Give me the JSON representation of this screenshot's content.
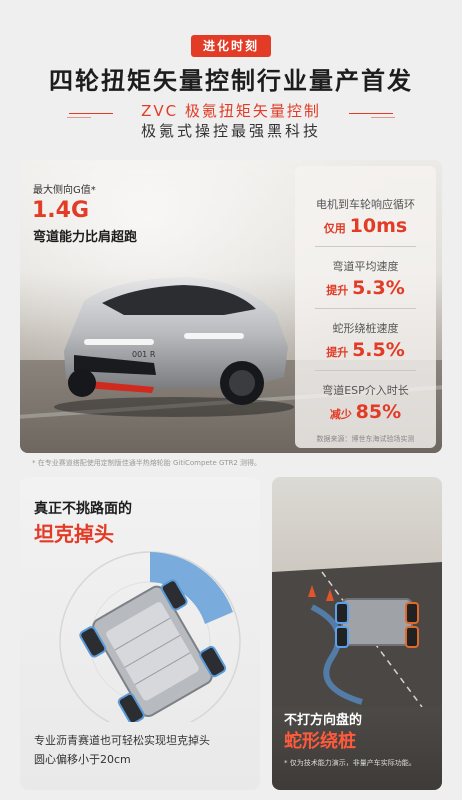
{
  "header": {
    "tag": "进化时刻",
    "headline": "四轮扭矩矢量控制行业量产首发",
    "subtitle_red": "ZVC 极氪扭矩矢量控制",
    "subtitle_dark": "极氪式操控最强黑科技"
  },
  "hero": {
    "g_label": "最大侧向G值*",
    "g_value": "1.4G",
    "g_desc": "弯道能力比肩超跑",
    "car_badge": "001 R",
    "stats": [
      {
        "label": "电机到车轮响应循环",
        "prefix": "仅用",
        "value": "10ms"
      },
      {
        "label": "弯道平均速度",
        "prefix": "提升",
        "value": "5.3%"
      },
      {
        "label": "蛇形绕桩速度",
        "prefix": "提升",
        "value": "5.5%"
      },
      {
        "label": "弯道ESP介入时长",
        "prefix": "减少",
        "value": "85%"
      }
    ],
    "source": "数据来源：博世东海试验场实测",
    "footnote": "* 在专业赛道搭配使用定制版佳通半热熔轮胎 GitiCompete GTR2 测得。"
  },
  "card_left": {
    "title_dark": "真正不挑路面的",
    "title_red": "坦克掉头",
    "desc_1": "专业沥青赛道也可轻松实现坦克掉头",
    "desc_2": "圆心偏移小于20cm"
  },
  "card_right": {
    "title_dark": "不打方向盘的",
    "title_red": "蛇形绕桩",
    "footnote": "* 仅为技术能力演示，非量产车实际功能。"
  },
  "colors": {
    "accent": "#e23b26",
    "text": "#1d1d1d",
    "background": "#efefef"
  }
}
